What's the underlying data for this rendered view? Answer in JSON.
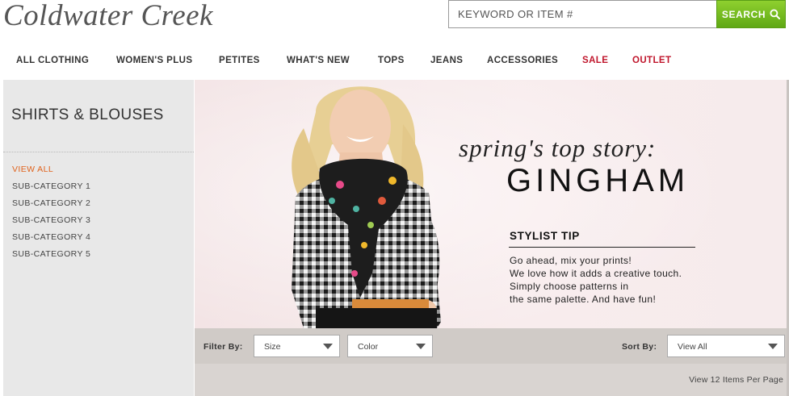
{
  "brand": {
    "name": "Coldwater Creek"
  },
  "search": {
    "placeholder": "KEYWORD OR ITEM #",
    "button_label": "SEARCH"
  },
  "nav": [
    {
      "label": "ALL CLOTHING"
    },
    {
      "label": "WOMEN'S PLUS"
    },
    {
      "label": "PETITES"
    },
    {
      "label": "WHAT'S NEW"
    },
    {
      "label": "TOPS"
    },
    {
      "label": "JEANS"
    },
    {
      "label": "ACCESSORIES"
    },
    {
      "label": "SALE",
      "color": "#c0162c"
    },
    {
      "label": "OUTLET",
      "color": "#c0162c"
    }
  ],
  "sidebar": {
    "title": "SHIRTS & BLOUSES",
    "categories": [
      {
        "label": "VIEW ALL",
        "active": true
      },
      {
        "label": "SUB-CATEGORY 1"
      },
      {
        "label": "SUB-CATEGORY 2"
      },
      {
        "label": "SUB-CATEGORY 3"
      },
      {
        "label": "SUB-CATEGORY 4"
      },
      {
        "label": "SUB-CATEGORY 5"
      }
    ]
  },
  "hero": {
    "tagline": "spring's top story:",
    "headline": "GINGHAM",
    "tip_title": "STYLIST TIP",
    "tip_lines": [
      "Go ahead, mix your prints!",
      "We love how it adds a creative touch.",
      "Simply choose patterns in",
      "the same palette. And have fun!"
    ]
  },
  "filters": {
    "filter_label": "Filter By:",
    "size_value": "Size",
    "color_value": "Color",
    "sort_label": "Sort By:",
    "sort_value": "View All"
  },
  "results": {
    "per_page_text": "View 12 Items Per Page"
  },
  "colors": {
    "accent_green": "#6bb81c",
    "sale_red": "#c0162c",
    "active_orange": "#e0631d"
  },
  "icons": {
    "search": "search-icon",
    "dropdown": "chevron-down-icon"
  }
}
